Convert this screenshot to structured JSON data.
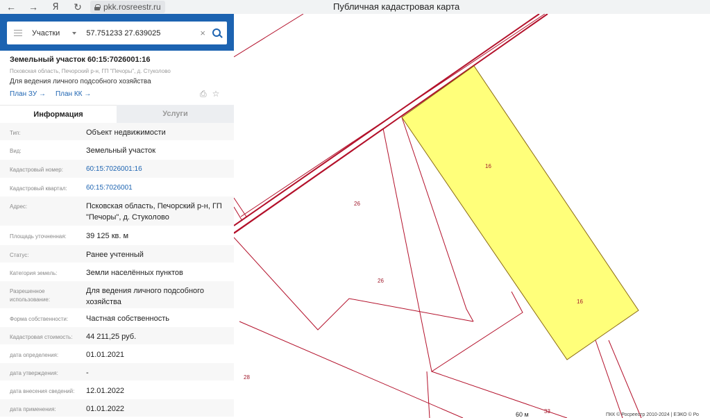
{
  "browser": {
    "back_icon": "←",
    "forward_icon": "→",
    "yandex_icon": "Я",
    "reload_icon": "↻",
    "url": "pkk.rosreestr.ru",
    "page_title": "Публичная кадастровая карта"
  },
  "search": {
    "layer": "Участки",
    "query": "57.751233 27.639025",
    "clear_icon": "×",
    "collapse_icon": "‹"
  },
  "parcel": {
    "title": "Земельный участок 60:15:7026001:16",
    "address": "Псковская область, Печорский р-н, ГП \"Печоры\", д. Стуколово",
    "use": "Для ведения личного подсобного хозяйства",
    "plan_zu": "План ЗУ →",
    "plan_kk": "План КК →",
    "icon_print": "⎙",
    "icon_star": "☆"
  },
  "tabs": {
    "info": "Информация",
    "services": "Услуги"
  },
  "rows": [
    {
      "k": "Тип:",
      "v": "Объект недвижимости"
    },
    {
      "k": "Вид:",
      "v": "Земельный участок"
    },
    {
      "k": "Кадастровый номер:",
      "v": "60:15:7026001:16"
    },
    {
      "k": "Кадастровый квартал:",
      "v": "60:15:7026001"
    },
    {
      "k": "Адрес:",
      "v": "Псковская область, Печорский р-н, ГП \"Печоры\", д. Стуколово"
    },
    {
      "k": "Площадь уточненная:",
      "v": "39 125 кв. м"
    },
    {
      "k": "Статус:",
      "v": "Ранее учтенный"
    },
    {
      "k": "Категория земель:",
      "v": "Земли населённых пунктов"
    },
    {
      "k": "Разрешенное использование:",
      "v": "Для ведения личного подсобного хозяйства"
    },
    {
      "k": "Форма собственности:",
      "v": "Частная собственность"
    },
    {
      "k": "Кадастровая стоимость:",
      "v": "44 211,25 руб."
    },
    {
      "k": "дата определения:",
      "v": "01.01.2021"
    },
    {
      "k": "дата утверждения:",
      "v": "-"
    },
    {
      "k": "дата внесения сведений:",
      "v": "12.01.2022"
    },
    {
      "k": "дата применения:",
      "v": "01.01.2022"
    }
  ],
  "map": {
    "labels": [
      "16",
      "16",
      "26",
      "26",
      "28",
      "33"
    ],
    "scale": "60 м",
    "copyright": "ПКК © Росреестр 2010-2024 | ЕЭКО © Ро"
  }
}
